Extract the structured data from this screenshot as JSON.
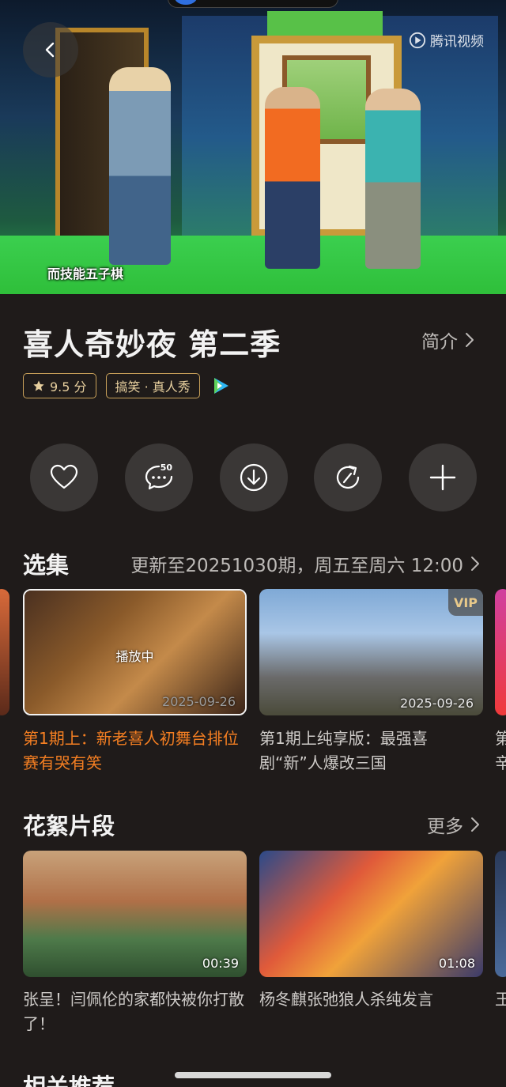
{
  "player": {
    "subtitle": "而技能五子棋",
    "watermark": "腾讯视频"
  },
  "show": {
    "title": "喜人奇妙夜 第二季",
    "intro_label": "简介",
    "rating": "9.5 分",
    "genre": "搞笑 · 真人秀"
  },
  "actions": {
    "comment_count": "50"
  },
  "episodes": {
    "section_title": "选集",
    "update_info": "更新至20251030期，周五至周六 12:00",
    "items": [
      {
        "playing_label": "播放中",
        "date": "2025-09-26",
        "title": "第1期上：新老喜人初舞台排位赛有哭有笑"
      },
      {
        "vip_label": "VIP",
        "date": "2025-09-26",
        "title": "第1期上纯享版：最强喜剧“新”人爆改三国"
      }
    ],
    "edge_text": "第辛"
  },
  "clips": {
    "section_title": "花絮片段",
    "more_label": "更多",
    "items": [
      {
        "duration": "00:39",
        "title": "张呈！闫佩伦的家都快被你打散了！"
      },
      {
        "duration": "01:08",
        "title": "杨冬麒张弛狼人杀纯发言"
      }
    ],
    "edge_text": "王"
  },
  "related": {
    "section_title": "相关推荐"
  },
  "colors": {
    "background": "#1f1b1a",
    "accent_orange": "#f57f22",
    "tag_gold": "#c9a15a"
  }
}
